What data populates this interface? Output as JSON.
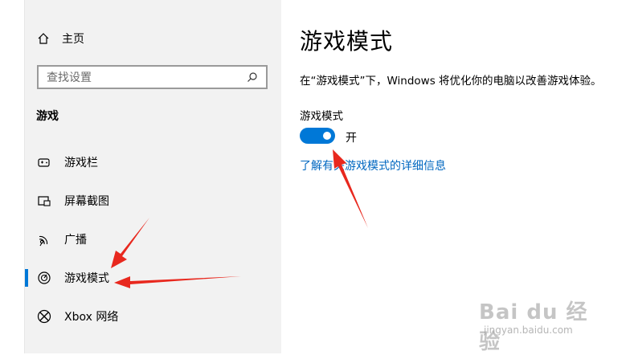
{
  "sidebar": {
    "home_label": "主页",
    "search_placeholder": "查找设置",
    "section_title": "游戏",
    "items": [
      {
        "label": "游戏栏",
        "icon": "game-bar-icon"
      },
      {
        "label": "屏幕截图",
        "icon": "screenshot-icon"
      },
      {
        "label": "广播",
        "icon": "broadcast-icon"
      },
      {
        "label": "游戏模式",
        "icon": "game-mode-icon",
        "active": true
      },
      {
        "label": "Xbox 网络",
        "icon": "xbox-icon"
      }
    ]
  },
  "main": {
    "title": "游戏模式",
    "description": "在“游戏模式”下，Windows 将优化你的电脑以改善游戏体验。",
    "toggle_label": "游戏模式",
    "toggle_state": "开",
    "learn_more": "了解有关游戏模式的详细信息"
  },
  "watermark": {
    "text": "Bai du 经验",
    "url": "jingyan.baidu.com"
  },
  "colors": {
    "accent": "#0078d7",
    "link": "#0067c0",
    "sidebar_bg": "#f2f2f2",
    "annotation_arrow": "#e8281e"
  }
}
